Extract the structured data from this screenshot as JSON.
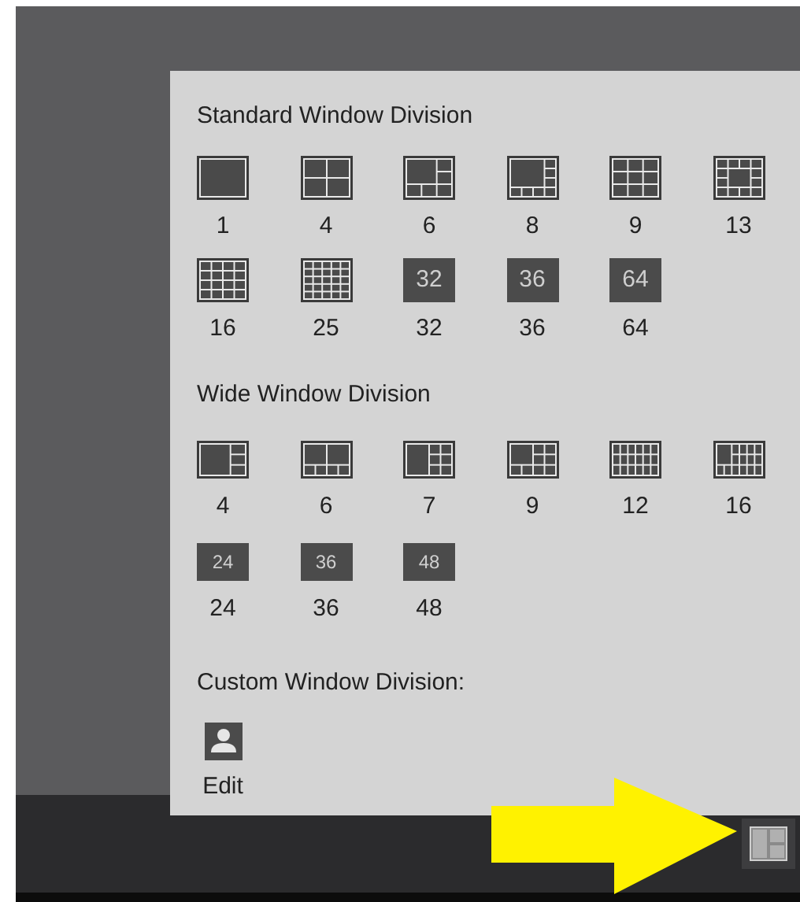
{
  "popup": {
    "sections": [
      {
        "title": "Standard Window Division",
        "kind": "standard",
        "items": [
          {
            "kind": "grid",
            "label": "1"
          },
          {
            "kind": "grid",
            "label": "4"
          },
          {
            "kind": "grid",
            "label": "6"
          },
          {
            "kind": "grid",
            "label": "8"
          },
          {
            "kind": "grid",
            "label": "9"
          },
          {
            "kind": "grid",
            "label": "13"
          },
          {
            "kind": "grid",
            "label": "16"
          },
          {
            "kind": "grid",
            "label": "25"
          },
          {
            "kind": "badge",
            "badge": "32",
            "label": "32"
          },
          {
            "kind": "badge",
            "badge": "36",
            "label": "36"
          },
          {
            "kind": "badge",
            "badge": "64",
            "label": "64"
          }
        ]
      },
      {
        "title": "Wide Window Division",
        "kind": "wide",
        "items": [
          {
            "kind": "grid",
            "label": "4"
          },
          {
            "kind": "grid",
            "label": "6"
          },
          {
            "kind": "grid",
            "label": "7"
          },
          {
            "kind": "grid",
            "label": "9"
          },
          {
            "kind": "grid",
            "label": "12"
          },
          {
            "kind": "grid",
            "label": "16"
          },
          {
            "kind": "badge",
            "badge": "24",
            "label": "24"
          },
          {
            "kind": "badge",
            "badge": "36",
            "label": "36"
          },
          {
            "kind": "badge",
            "badge": "48",
            "label": "48"
          }
        ]
      },
      {
        "title": "Custom Window Division:",
        "kind": "custom",
        "items": [
          {
            "kind": "edit",
            "label": "Edit"
          }
        ]
      }
    ]
  }
}
